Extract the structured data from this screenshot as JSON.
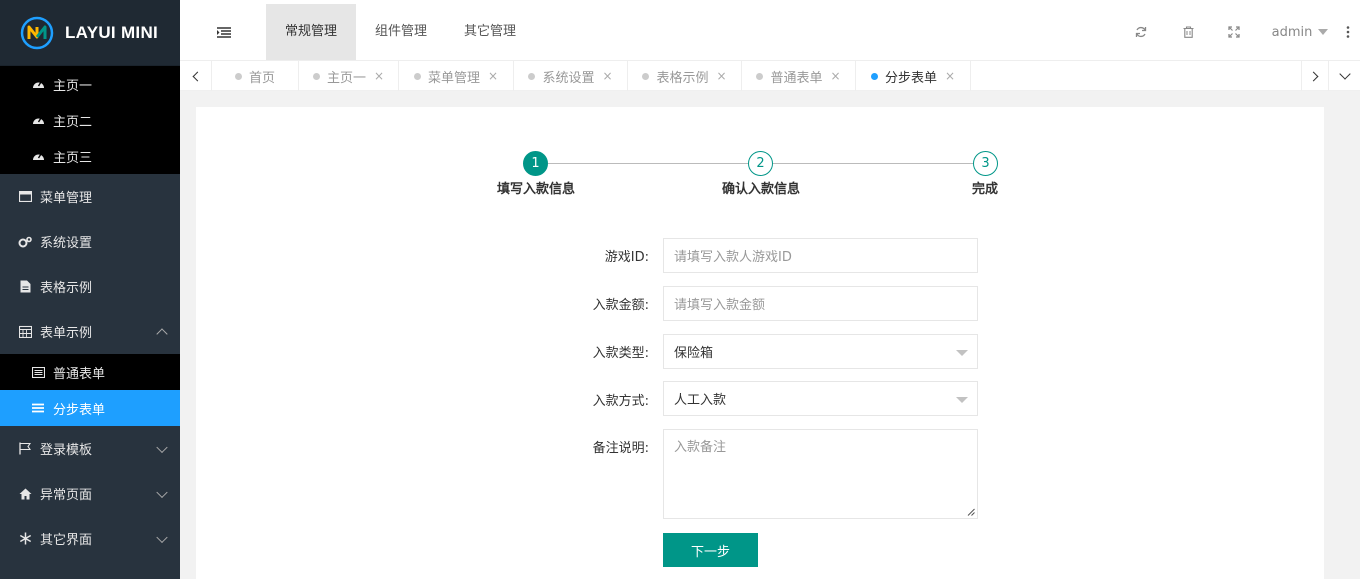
{
  "app": {
    "logo_text": "LAYUI MINI"
  },
  "header": {
    "nav": [
      "常规管理",
      "组件管理",
      "其它管理"
    ],
    "user": "admin"
  },
  "tabs": {
    "items": [
      {
        "label": "首页",
        "closable": false
      },
      {
        "label": "主页一",
        "closable": true
      },
      {
        "label": "菜单管理",
        "closable": true
      },
      {
        "label": "系统设置",
        "closable": true
      },
      {
        "label": "表格示例",
        "closable": true
      },
      {
        "label": "普通表单",
        "closable": true
      },
      {
        "label": "分步表单",
        "closable": true,
        "active": true
      }
    ],
    "close_glyph": "×"
  },
  "sidebar": {
    "home_items": [
      "主页一",
      "主页二",
      "主页三"
    ],
    "items": [
      "菜单管理",
      "系统设置",
      "表格示例",
      "表单示例"
    ],
    "form_children": [
      "普通表单",
      "分步表单"
    ],
    "bottom_items": [
      "登录模板",
      "异常页面",
      "其它界面"
    ]
  },
  "steps": [
    {
      "num": "1",
      "label": "填写入款信息",
      "state": "current"
    },
    {
      "num": "2",
      "label": "确认入款信息",
      "state": "todo"
    },
    {
      "num": "3",
      "label": "完成",
      "state": "todo"
    }
  ],
  "form": {
    "game_id": {
      "label": "游戏ID:",
      "placeholder": "请填写入款人游戏ID"
    },
    "amount": {
      "label": "入款金额:",
      "placeholder": "请填写入款金额"
    },
    "type": {
      "label": "入款类型:",
      "value": "保险箱"
    },
    "method": {
      "label": "入款方式:",
      "value": "人工入款"
    },
    "remark": {
      "label": "备注说明:",
      "placeholder": "入款备注"
    },
    "next_button": "下一步"
  },
  "colors": {
    "accent": "#009688",
    "active_blue": "#1e9fff",
    "sidebar_bg": "#28333e"
  }
}
